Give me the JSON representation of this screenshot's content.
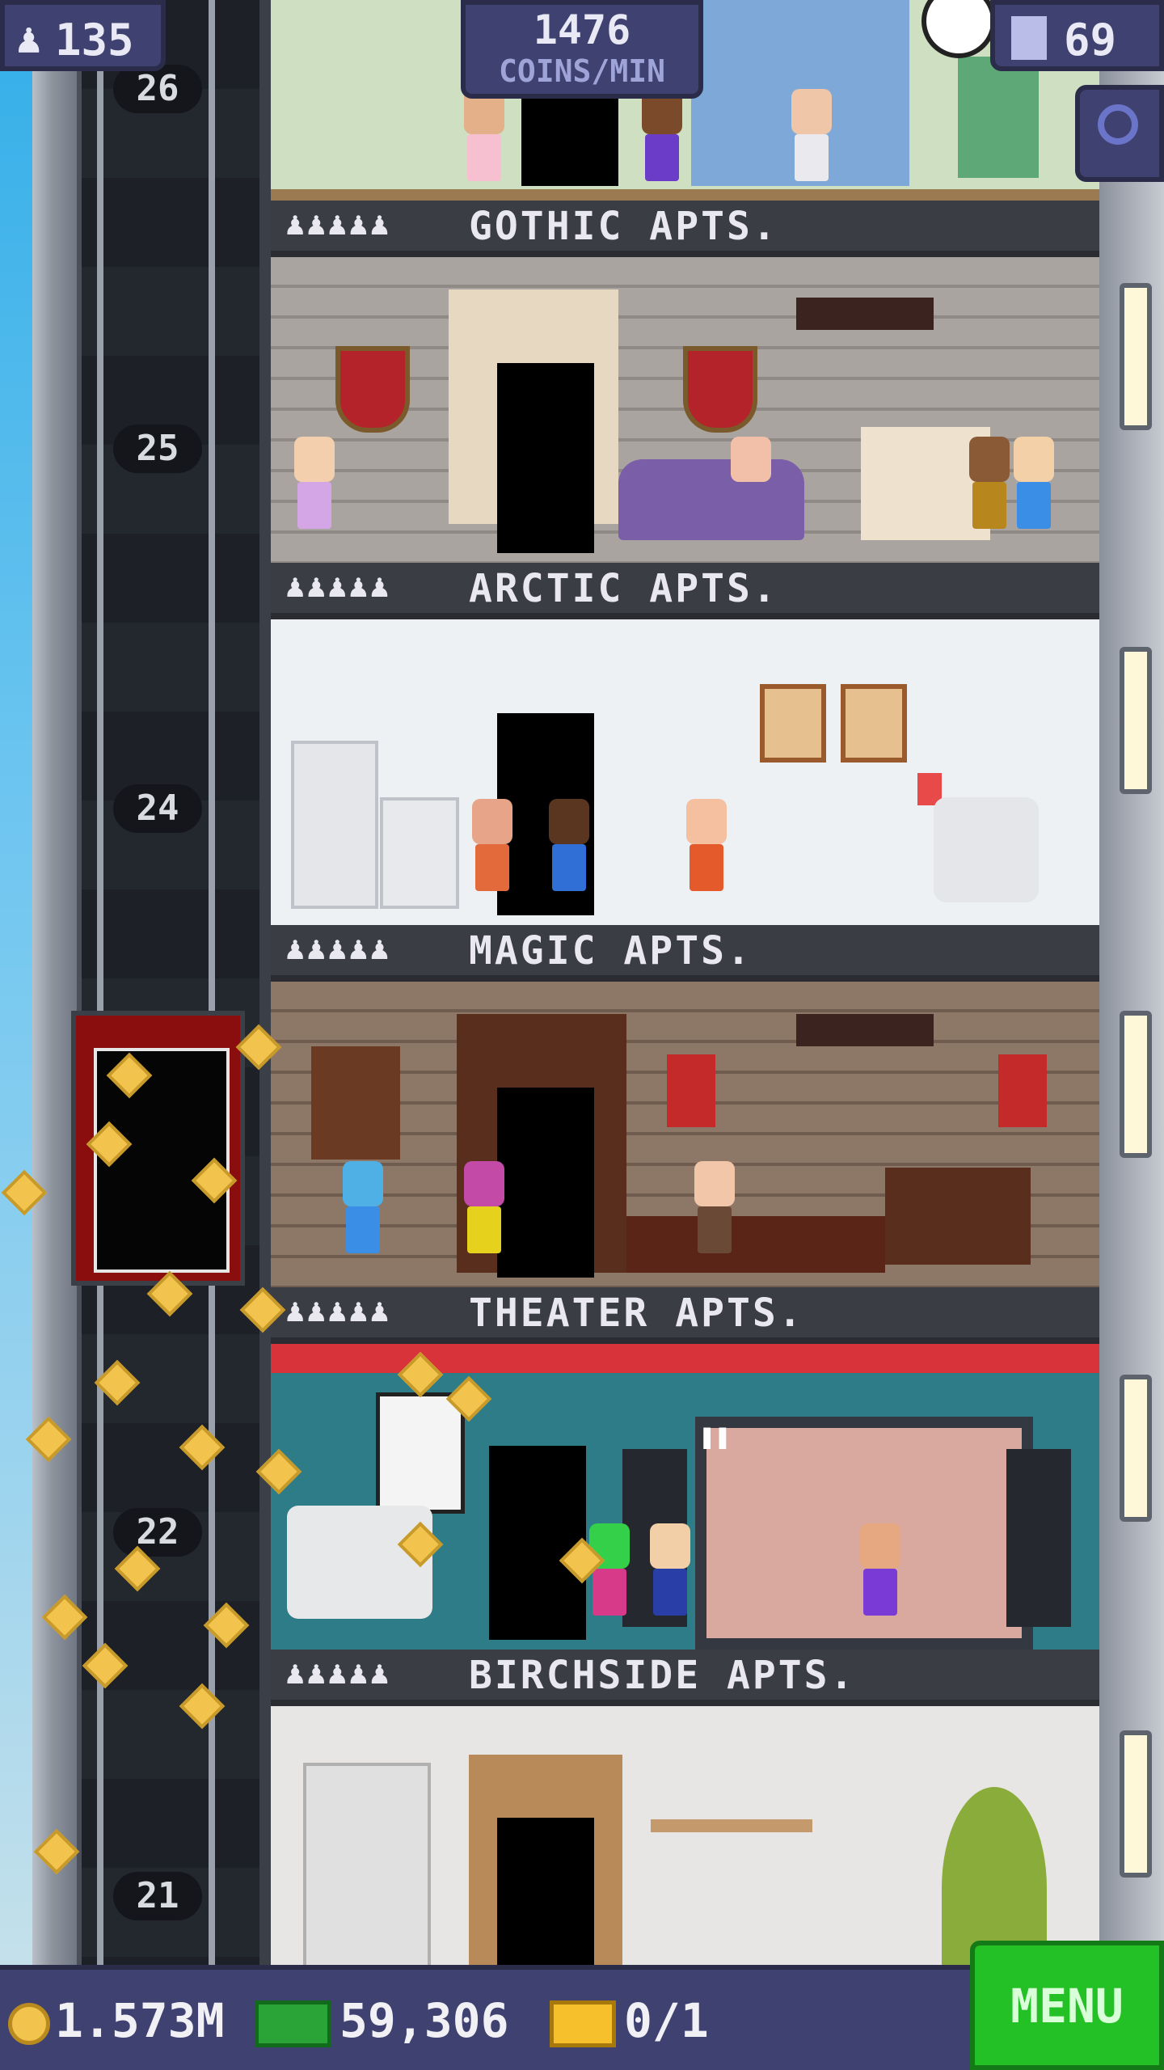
{
  "hud": {
    "population": "135",
    "coins_rate_value": "1476",
    "coins_rate_unit": "COINS/MIN",
    "floors": "69"
  },
  "elevator": {
    "floor_numbers": [
      "26",
      "25",
      "24",
      "22",
      "21"
    ]
  },
  "floors": [
    {
      "name": "GOTHIC APTS.",
      "residents_icon": "♟♟♟♟♟"
    },
    {
      "name": "ARCTIC APTS.",
      "residents_icon": "♟♟♟♟♟"
    },
    {
      "name": "MAGIC APTS.",
      "residents_icon": "♟♟♟♟♟"
    },
    {
      "name": "THEATER APTS.",
      "residents_icon": "♟♟♟♟♟"
    },
    {
      "name": "BIRCHSIDE APTS.",
      "residents_icon": "♟♟♟♟♟"
    }
  ],
  "bottom_bar": {
    "coins": "1.573M",
    "bux": "59,306",
    "tickets": "0/1",
    "menu_label": "MENU"
  },
  "colors": {
    "hud_bg": "#3f4270",
    "menu_green": "#23c026",
    "coin_gold": "#f2c44d"
  }
}
